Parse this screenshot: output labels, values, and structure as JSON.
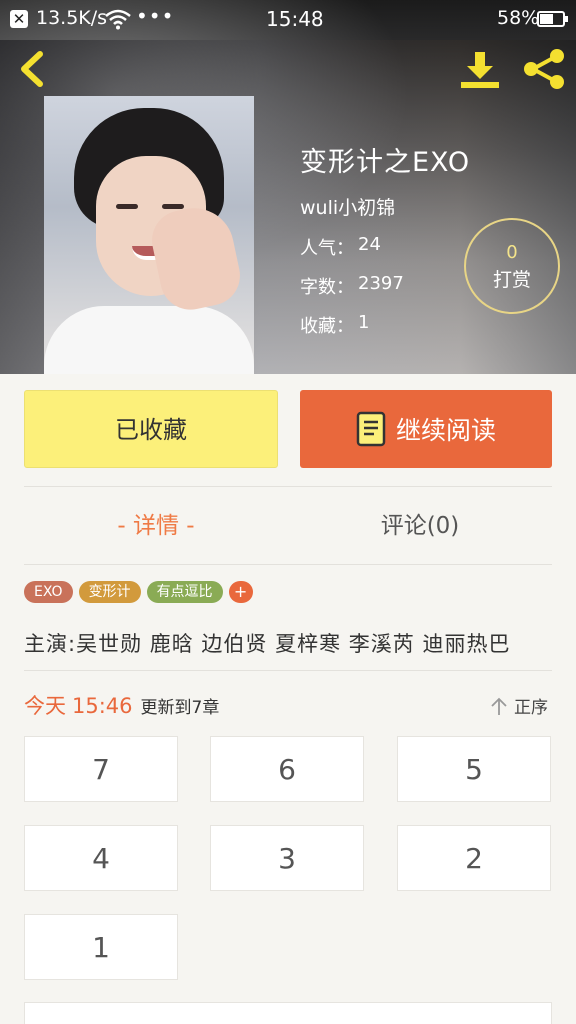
{
  "status_bar": {
    "speed": "13.5K/s",
    "dots": "•••",
    "time": "15:48",
    "battery": "58%",
    "battery_level": 0.58
  },
  "header": {
    "back_icon": "chevron-left-icon",
    "download_icon": "download-icon",
    "share_icon": "share-icon",
    "accent": "#f4e030"
  },
  "book": {
    "title": "变形计之EXO",
    "author": "wuli小初锦",
    "stats": [
      {
        "label": "人气：",
        "value": "24"
      },
      {
        "label": "字数：",
        "value": "2397"
      },
      {
        "label": "收藏：",
        "value": "1"
      }
    ]
  },
  "reward": {
    "count": "0",
    "label": "打赏"
  },
  "actions": {
    "favorite_label": "已收藏",
    "read_label": "继续阅读",
    "favorite_color": "#fcf07a",
    "read_color": "#e9683c"
  },
  "tabs": {
    "detail": "- 详情 -",
    "comments": "评论(0)"
  },
  "tags": [
    {
      "label": "EXO",
      "color": "#c9725a"
    },
    {
      "label": "变形计",
      "color": "#d29a3c"
    },
    {
      "label": "有点逗比",
      "color": "#8aab55"
    }
  ],
  "tag_add": "+",
  "cast": "主演:吴世勋 鹿晗 边伯贤 夏梓寒 李溪芮 迪丽热巴",
  "update": {
    "day": "今天",
    "time": "15:46",
    "text": "更新到7章"
  },
  "sort_label": "正序",
  "chapters": [
    "7",
    "6",
    "5",
    "4",
    "3",
    "2",
    "1"
  ]
}
